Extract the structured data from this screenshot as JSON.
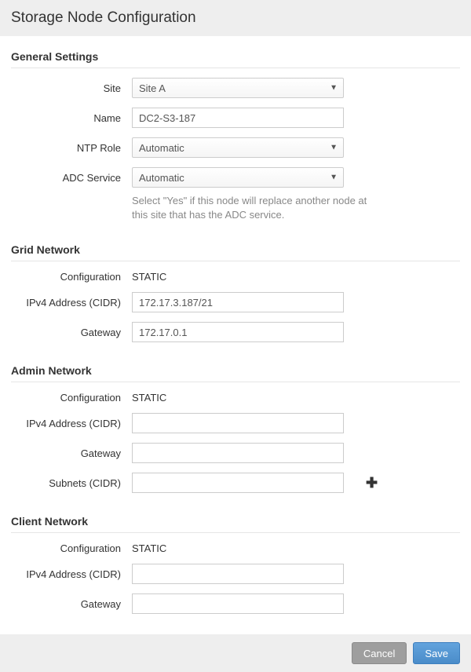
{
  "header": {
    "title": "Storage Node Configuration"
  },
  "general": {
    "section_title": "General Settings",
    "labels": {
      "site": "Site",
      "name": "Name",
      "ntp_role": "NTP Role",
      "adc_service": "ADC Service"
    },
    "values": {
      "site": "Site A",
      "name": "DC2-S3-187",
      "ntp_role": "Automatic",
      "adc_service": "Automatic"
    },
    "adc_help": "Select \"Yes\" if this node will replace another node at this site that has the ADC service."
  },
  "grid": {
    "section_title": "Grid Network",
    "labels": {
      "configuration": "Configuration",
      "ipv4": "IPv4 Address (CIDR)",
      "gateway": "Gateway"
    },
    "values": {
      "configuration": "STATIC",
      "ipv4": "172.17.3.187/21",
      "gateway": "172.17.0.1"
    }
  },
  "admin": {
    "section_title": "Admin Network",
    "labels": {
      "configuration": "Configuration",
      "ipv4": "IPv4 Address (CIDR)",
      "gateway": "Gateway",
      "subnets": "Subnets (CIDR)"
    },
    "values": {
      "configuration": "STATIC",
      "ipv4": "",
      "gateway": "",
      "subnets": ""
    }
  },
  "client": {
    "section_title": "Client Network",
    "labels": {
      "configuration": "Configuration",
      "ipv4": "IPv4 Address (CIDR)",
      "gateway": "Gateway"
    },
    "values": {
      "configuration": "STATIC",
      "ipv4": "",
      "gateway": ""
    }
  },
  "footer": {
    "cancel": "Cancel",
    "save": "Save"
  }
}
